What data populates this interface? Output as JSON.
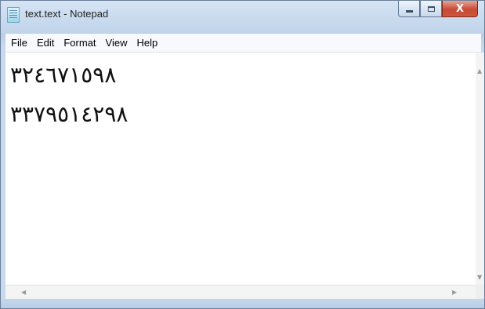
{
  "window": {
    "title": "text.text - Notepad",
    "close_symbol": "X",
    "app_icon": "notepad-icon"
  },
  "menu": {
    "items": [
      "File",
      "Edit",
      "Format",
      "View",
      "Help"
    ]
  },
  "editor": {
    "lines": [
      "٣٢٤٦٧١٥٩٨",
      "٣٣٧٩٥١٤٢٩٨"
    ]
  },
  "scrollbars": {
    "up_arrow": "▲",
    "down_arrow": "▼",
    "left_arrow": "◀",
    "right_arrow": "▶"
  },
  "colors": {
    "titlebar": "#c9dbef",
    "close_button": "#c74a35",
    "editor_background": "#ffffff"
  }
}
